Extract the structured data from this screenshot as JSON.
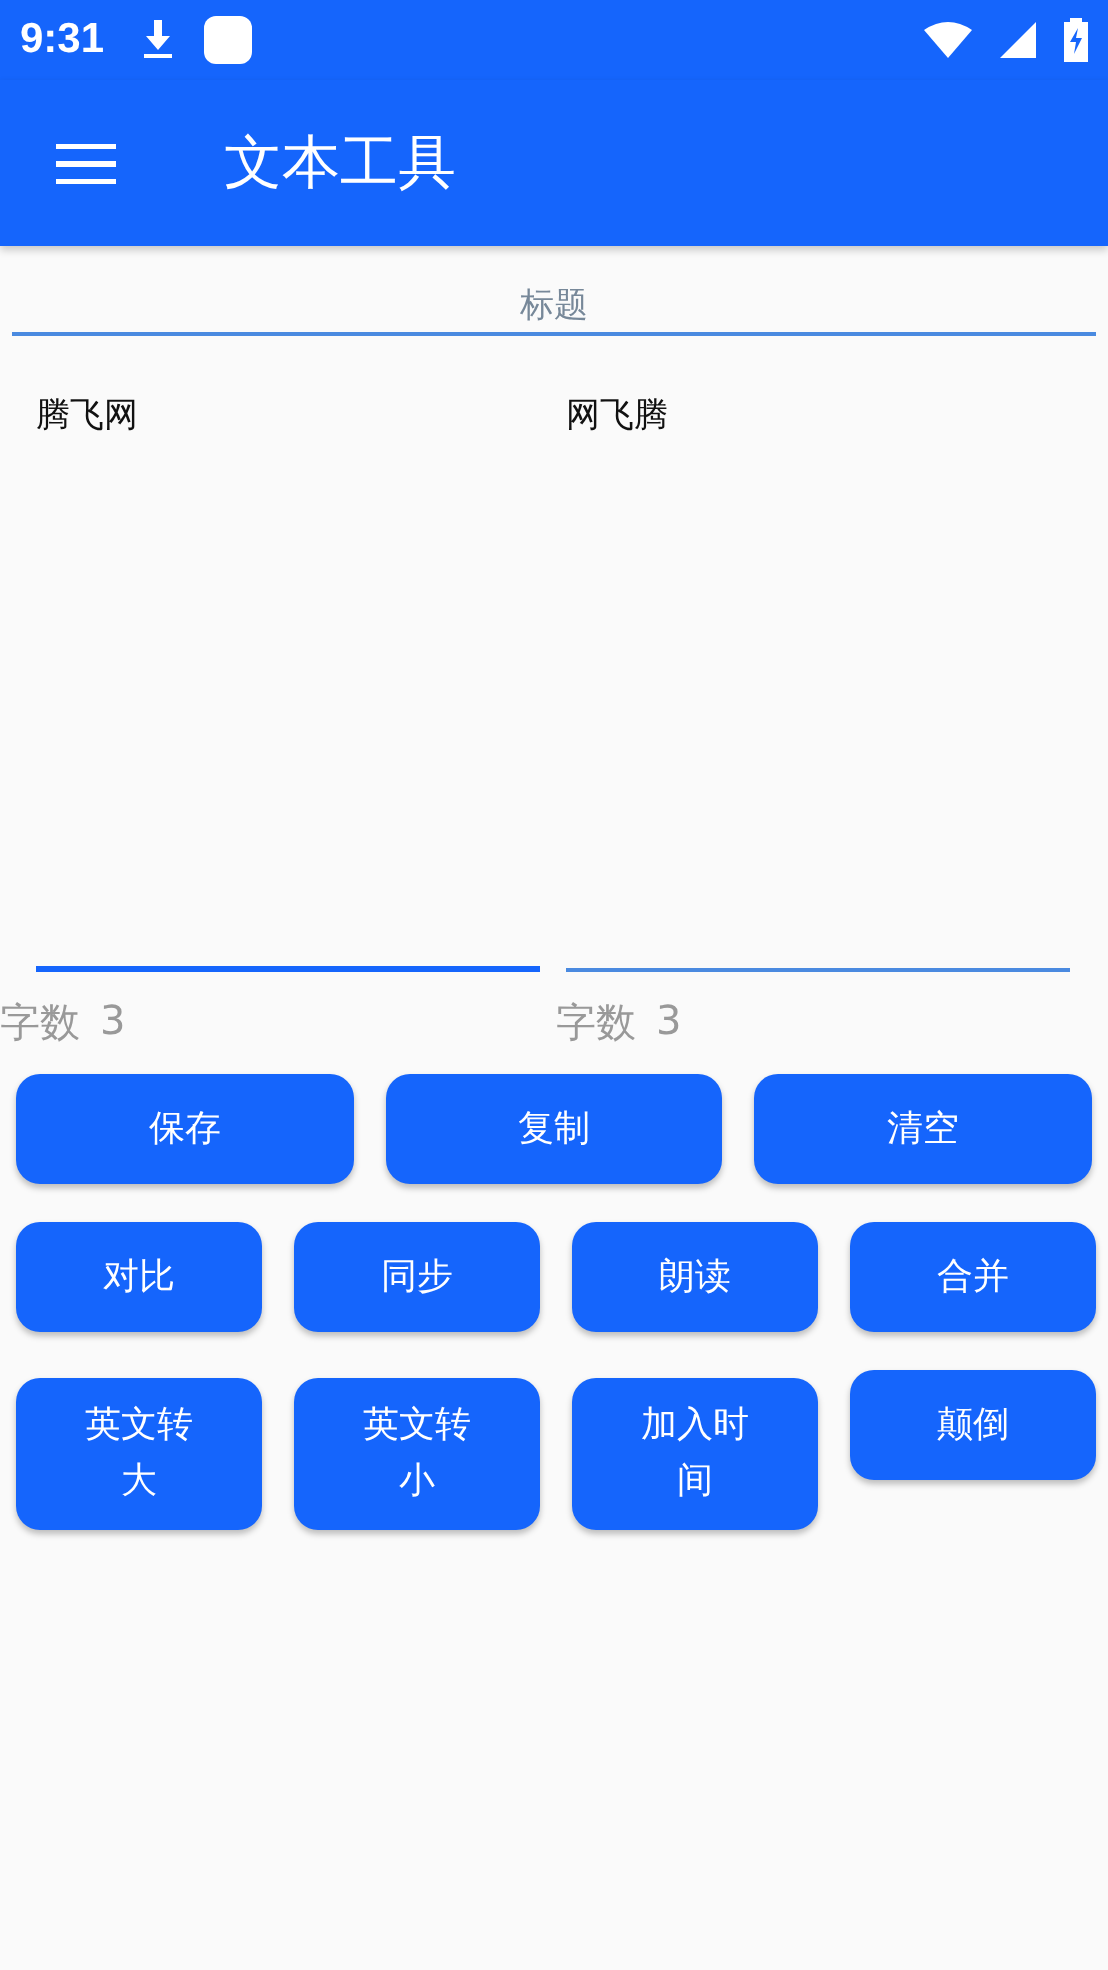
{
  "status_bar": {
    "time": "9:31"
  },
  "toolbar": {
    "title": "文本工具"
  },
  "title_field": {
    "placeholder": "标题"
  },
  "editors": [
    {
      "value": "腾飞网",
      "focused": true,
      "count_label": "字数",
      "count": "3"
    },
    {
      "value": "网飞腾",
      "focused": false,
      "count_label": "字数",
      "count": "3"
    }
  ],
  "button_rows": [
    [
      "保存",
      "复制",
      "清空"
    ],
    [
      "对比",
      "同步",
      "朗读",
      "合并"
    ],
    [
      "英文转大",
      "英文转小",
      "加入时间",
      "颠倒"
    ]
  ]
}
